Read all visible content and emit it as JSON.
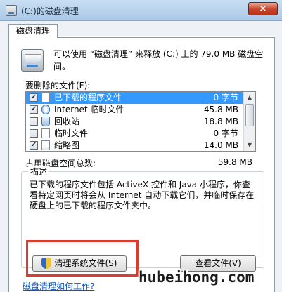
{
  "window": {
    "title": "(C:)的磁盘清理",
    "close_glyph": "×",
    "icon": "disk-cleanup-icon"
  },
  "tabs": [
    {
      "label": "磁盘清理"
    }
  ],
  "header": {
    "text": "可以使用 “磁盘清理” 来释放 (C:) 上的 79.0 MB 磁盘空间。",
    "icon": "drive-icon"
  },
  "files_label": "要删除的文件(F):",
  "files": [
    {
      "checked": true,
      "name": "已下载的程序文件",
      "size": "0 字节",
      "selected": true,
      "icon": "folder-icon"
    },
    {
      "checked": true,
      "name": "Internet 临时文件",
      "size": "45.8 MB",
      "selected": false,
      "icon": "internet-explorer-icon"
    },
    {
      "checked": false,
      "name": "回收站",
      "size": "18.8 MB",
      "selected": false,
      "icon": "recycle-bin-icon"
    },
    {
      "checked": false,
      "name": "临时文件",
      "size": "0 字节",
      "selected": false,
      "icon": "file-icon"
    },
    {
      "checked": true,
      "name": "缩略图",
      "size": "14.0 MB",
      "selected": false,
      "icon": "thumbnail-icon"
    }
  ],
  "check_glyph": "✔",
  "scrollbar": {
    "up": "▲",
    "down": "▼"
  },
  "total": {
    "label": "占用磁盘空间总数:",
    "value": "59.8 MB"
  },
  "description": {
    "title": "描述",
    "text": "已下载的程序文件包括 ActiveX 控件和 Java 小程序，你查看特定网页时将会从 Internet 自动下载它们，并临时保存在硬盘上的已下载的程序文件夹中。"
  },
  "buttons": {
    "cleanup_system": "清理系统文件(S)",
    "view_files": "查看文件(V)"
  },
  "help_link": "磁盘清理如何工作?",
  "watermark": "hubeihong.com",
  "colors": {
    "selection": "#3399ff",
    "highlight_box": "#e03a2e",
    "link": "#0b55c4"
  }
}
